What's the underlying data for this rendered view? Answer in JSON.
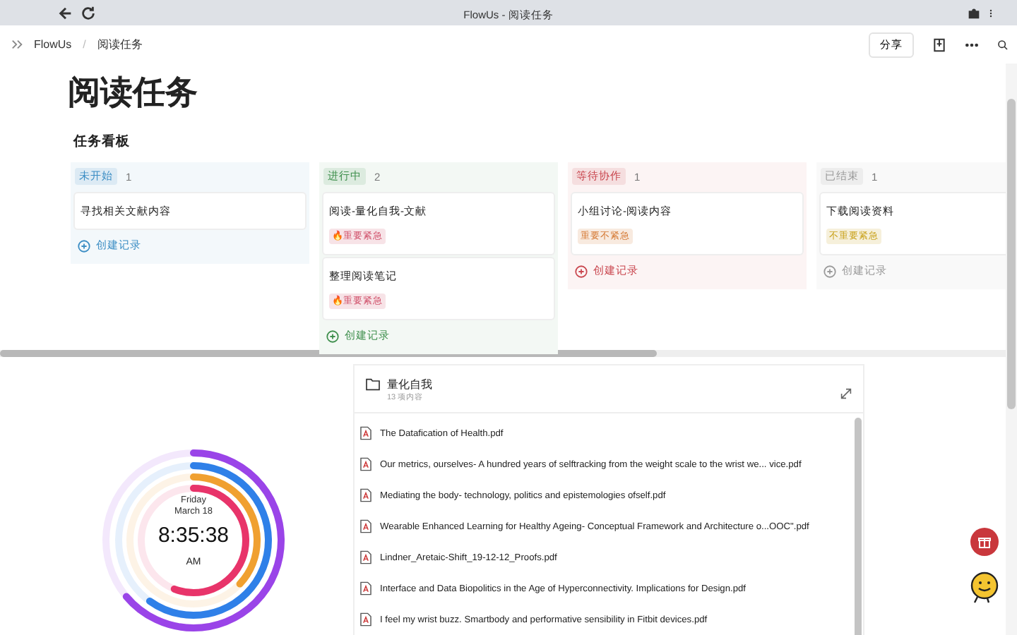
{
  "browser": {
    "title": "FlowUs - 阅读任务"
  },
  "breadcrumb": {
    "items": [
      "FlowUs",
      "阅读任务"
    ],
    "separator": "/"
  },
  "toolbar": {
    "share": "分享"
  },
  "page": {
    "title": "阅读任务"
  },
  "board": {
    "title": "任务看板",
    "columns": [
      {
        "status": "未开始",
        "color": "#3b8dc4",
        "count": "1",
        "cards": [
          {
            "title": "寻找相关文献内容"
          }
        ],
        "add": "创建记录"
      },
      {
        "status": "进行中",
        "color": "#3f8f4d",
        "count": "2",
        "cards": [
          {
            "title": "阅读-量化自我-文献",
            "tag": {
              "label": "🔥重要紧急",
              "color": "#d0506a"
            }
          },
          {
            "title": "整理阅读笔记",
            "tag": {
              "label": "🔥重要紧急",
              "color": "#d0506a"
            }
          }
        ],
        "add": "创建记录"
      },
      {
        "status": "等待协作",
        "color": "#c9464e",
        "count": "1",
        "cards": [
          {
            "title": "小组讨论-阅读内容",
            "tag": {
              "label": "重要不紧急",
              "color": "#d57a35"
            }
          }
        ],
        "add": "创建记录"
      },
      {
        "status": "已结束",
        "color": "#9a9a9a",
        "count": "1",
        "cards": [
          {
            "title": "下载阅读资料",
            "tag": {
              "label": "不重要紧急",
              "color": "#c9a21c"
            }
          }
        ],
        "add": "创建记录"
      }
    ]
  },
  "clock": {
    "day": "Friday",
    "date": "March 18",
    "time": "8:35:38",
    "period": "AM",
    "rings": [
      {
        "level": 0.64
      },
      {
        "level": 0.6
      },
      {
        "level": 0.37
      },
      {
        "level": 0.56
      }
    ]
  },
  "folder": {
    "title": "量化自我",
    "count": "13 项内容",
    "files": [
      "The Datafication of Health.pdf",
      "Our metrics, ourselves- A hundred years of selftracking from the weight scale to the wrist we... vice.pdf",
      "Mediating the body- technology, politics and epistemologies ofself.pdf",
      "Wearable Enhanced Learning for Healthy Ageing- Conceptual Framework and Architecture o...OOC\".pdf",
      "Lindner_Aretaic-Shift_19-12-12_Proofs.pdf",
      "Interface and Data Biopolitics in the Age of Hyperconnectivity. Implications for Design.pdf",
      "I feel my wrist buzz. Smartbody and performative sensibility in Fitbit devices.pdf"
    ]
  }
}
